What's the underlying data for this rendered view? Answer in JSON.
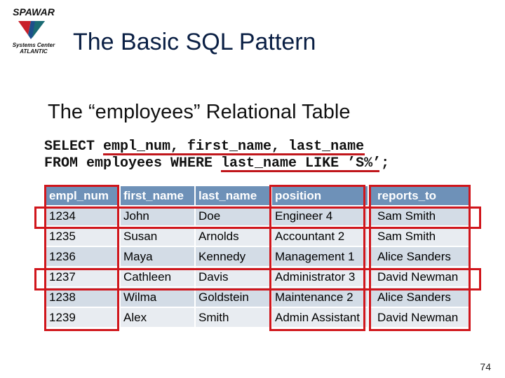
{
  "logo": {
    "brand": "SPAWAR",
    "line1": "Systems Center",
    "line2": "ATLANTIC"
  },
  "title": "The Basic SQL Pattern",
  "subtitle": "The “employees” Relational Table",
  "sql": {
    "line1": "SELECT empl_num, first_name, last_name",
    "line2": "FROM employees WHERE last_name LIKE ’S%’;"
  },
  "table": {
    "headers": [
      "empl_num",
      "first_name",
      "last_name",
      "position",
      "reports_to"
    ],
    "rows": [
      [
        "1234",
        "John",
        "Doe",
        "Engineer 4",
        "Sam Smith"
      ],
      [
        "1235",
        "Susan",
        "Arnolds",
        "Accountant 2",
        "Sam Smith"
      ],
      [
        "1236",
        "Maya",
        "Kennedy",
        "Management 1",
        "Alice Sanders"
      ],
      [
        "1237",
        "Cathleen",
        "Davis",
        "Administrator 3",
        "David Newman"
      ],
      [
        "1238",
        "Wilma",
        "Goldstein",
        "Maintenance 2",
        "Alice Sanders"
      ],
      [
        "1239",
        "Alex",
        "Smith",
        "Admin Assistant",
        "David Newman"
      ]
    ]
  },
  "highlight_color": "#d0161c",
  "page_number": "74"
}
